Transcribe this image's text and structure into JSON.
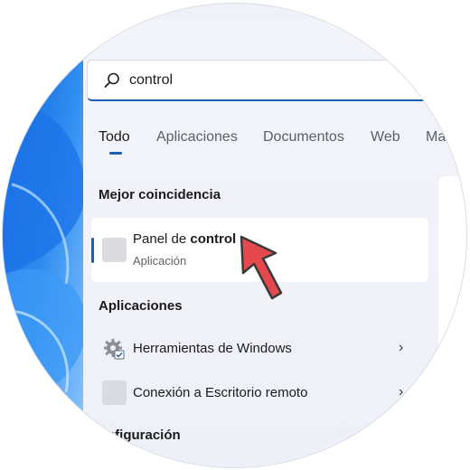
{
  "search": {
    "value": "control"
  },
  "tabs": [
    {
      "label": "Todo"
    },
    {
      "label": "Aplicaciones"
    },
    {
      "label": "Documentos"
    },
    {
      "label": "Web"
    },
    {
      "label": "Ma"
    }
  ],
  "best_match": {
    "heading": "Mejor coincidencia",
    "title_prefix": "Panel de ",
    "title_match": "control",
    "subtitle": "Aplicación"
  },
  "apps": {
    "heading": "Aplicaciones",
    "items": [
      {
        "label": "Herramientas de Windows",
        "icon": "gear-icon"
      },
      {
        "label": "Conexión a Escritorio remoto",
        "icon": "app-placeholder-icon"
      }
    ]
  },
  "settings": {
    "heading": "nfiguración"
  },
  "colors": {
    "accent": "#1a5fb4",
    "cursor": "#e5484d"
  }
}
